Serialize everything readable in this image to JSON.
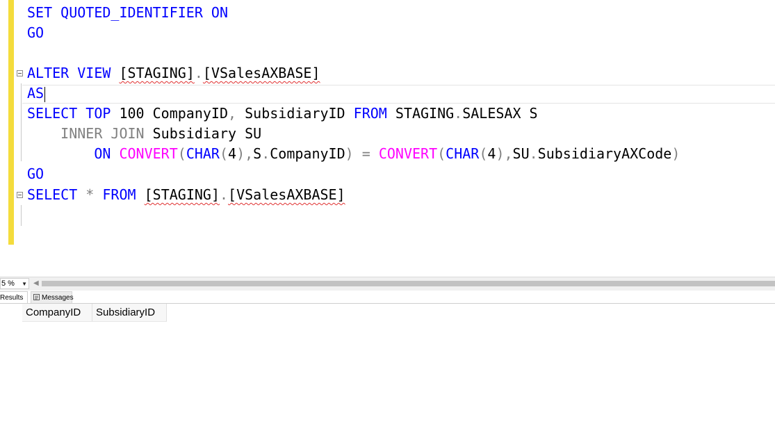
{
  "editor": {
    "l1": {
      "k1": "SET",
      "k2": "QUOTED_IDENTIFIER",
      "k3": "ON"
    },
    "l2": {
      "k1": "GO"
    },
    "l4": {
      "k1": "ALTER",
      "k2": "VIEW",
      "a": "[STAGING]",
      "dot": ".",
      "b": "[VSalesAXBASE]"
    },
    "l5": {
      "k1": "AS"
    },
    "l6": {
      "k1": "SELECT",
      "k2": "TOP",
      "t1": "100 CompanyID",
      "comma": ",",
      "t2": "SubsidiaryID",
      "k3": "FROM",
      "t3": "STAGING",
      "dot": ".",
      "t4": "SALESAX S"
    },
    "l7": {
      "g1": "INNER JOIN",
      "t1": "Subsidiary SU"
    },
    "l8": {
      "k1": "ON",
      "f1": "CONVERT",
      "p1": "(",
      "k2": "CHAR",
      "p2": "(",
      "n1": "4",
      "p3": ")",
      "c1": ",",
      "t1": "S",
      "d1": ".",
      "t2": "CompanyID",
      "p4": ")",
      "eq": "=",
      "f2": "CONVERT",
      "p5": "(",
      "k3": "CHAR",
      "p6": "(",
      "n2": "4",
      "p7": ")",
      "c2": ",",
      "t3": "SU",
      "d2": ".",
      "t4": "SubsidiaryAXCode",
      "p8": ")"
    },
    "l9": {
      "k1": "GO"
    },
    "l10": {
      "k1": "SELECT",
      "star": "*",
      "k2": "FROM",
      "a": "[STAGING]",
      "dot": ".",
      "b": "[VSalesAXBASE]"
    }
  },
  "statusbar": {
    "zoom": "5 %"
  },
  "tabs": {
    "results": "Results",
    "messages": "Messages"
  },
  "grid": {
    "columns": [
      "CompanyID",
      "SubsidiaryID"
    ]
  }
}
